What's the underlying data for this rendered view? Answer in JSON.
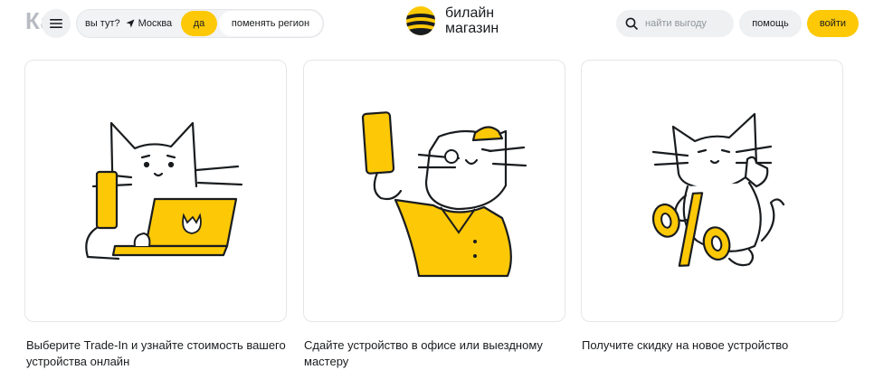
{
  "background_title": "Ка",
  "header": {
    "region": {
      "question": "вы тут?",
      "city": "Москва",
      "yes_label": "да",
      "change_label": "поменять регион"
    },
    "logo": {
      "line1": "билайн",
      "line2": "магазин"
    },
    "search": {
      "placeholder": "найти выгоду"
    },
    "help_label": "помощь",
    "login_label": "войти"
  },
  "steps": [
    {
      "caption": "Выберите Trade-In и узнайте стоимость вашего устройства онлайн",
      "illustration": "cat-with-phone-and-laptop"
    },
    {
      "caption": "Сдайте устройство в офисе или выездному мастеру",
      "illustration": "cat-courier-holding-phone"
    },
    {
      "caption": "Получите скидку на новое устройство",
      "illustration": "cat-with-percent-sign"
    }
  ],
  "colors": {
    "accent": "#fdc806",
    "text": "#191c1f",
    "muted": "#8f959c",
    "pill": "#eef0f2"
  }
}
